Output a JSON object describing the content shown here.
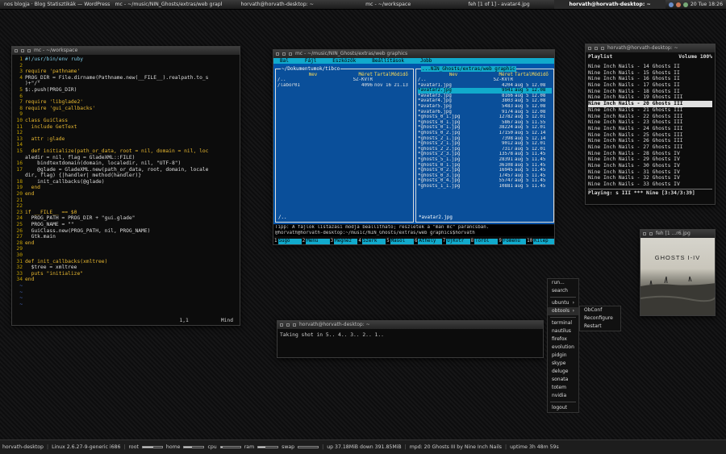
{
  "topbar": {
    "tasks": [
      {
        "label": "nos blogja · Blog Statisztikák — WordPress - M"
      },
      {
        "label": "mc - ~/music/NIN_Ghosts/extras/web graphic"
      },
      {
        "label": "horvath@horvath-desktop: ~"
      },
      {
        "label": "mc - ~/workspace"
      },
      {
        "label": "feh [1 of 1] - avatar4.jpg"
      },
      {
        "label": "horvath@horvath-desktop: ~"
      }
    ],
    "clock": "20 Tue 18:26"
  },
  "vim_window": {
    "title": "mc - ~/workspace",
    "lines": [
      {
        "n": "1",
        "text": "#!/usr/bin/env ruby"
      },
      {
        "n": "2",
        "text": ""
      },
      {
        "n": "3",
        "text": "require 'pathname'"
      },
      {
        "n": "4",
        "text": "PROG_DIR = File.dirname(Pathname.new(__FILE__).realpath.to_s"
      },
      {
        "n": "",
        "text": ")+\"/\""
      },
      {
        "n": "5",
        "text": "$:.push(PROG_DIR)"
      },
      {
        "n": "6",
        "text": ""
      },
      {
        "n": "7",
        "text": "require 'libglade2'"
      },
      {
        "n": "8",
        "text": "require 'gui_callbacks'"
      },
      {
        "n": "9",
        "text": ""
      },
      {
        "n": "10",
        "text": "class GuiClass"
      },
      {
        "n": "11",
        "text": "  include GetText"
      },
      {
        "n": "12",
        "text": ""
      },
      {
        "n": "13",
        "text": "  attr :glade"
      },
      {
        "n": "14",
        "text": ""
      },
      {
        "n": "15",
        "text": "  def initialize(path_or_data, root = nil, domain = nil, loc"
      },
      {
        "n": "",
        "text": "aledir = nil, flag = GladeXML::FILE)"
      },
      {
        "n": "16",
        "text": "    bindtextdomain(domain, localedir, nil, \"UTF-8\")"
      },
      {
        "n": "17",
        "text": "    @glade = GladeXML.new(path_or_data, root, domain, locale"
      },
      {
        "n": "",
        "text": "dir, flag) {|handler| method(handler)}"
      },
      {
        "n": "18",
        "text": "    init_callbacks(@glade)"
      },
      {
        "n": "19",
        "text": "  end"
      },
      {
        "n": "20",
        "text": "end"
      },
      {
        "n": "21",
        "text": ""
      },
      {
        "n": "22",
        "text": ""
      },
      {
        "n": "23",
        "text": "if __FILE__ == $0"
      },
      {
        "n": "24",
        "text": "  PROG_PATH = PROG_DIR + \"gui.glade\""
      },
      {
        "n": "25",
        "text": "  PROG_NAME = \"\""
      },
      {
        "n": "26",
        "text": "  GuiClass.new(PROG_PATH, nil, PROG_NAME)"
      },
      {
        "n": "27",
        "text": "  Gtk.main"
      },
      {
        "n": "28",
        "text": "end"
      },
      {
        "n": "29",
        "text": ""
      },
      {
        "n": "30",
        "text": ""
      },
      {
        "n": "31",
        "text": "def init_callbacks(xmltree)"
      },
      {
        "n": "32",
        "text": "  $tree = xmltree"
      },
      {
        "n": "33",
        "text": "  puts \"initialize\""
      },
      {
        "n": "34",
        "text": "end"
      },
      {
        "n": "~",
        "text": ""
      },
      {
        "n": "~",
        "text": ""
      },
      {
        "n": "~",
        "text": ""
      },
      {
        "n": "~",
        "text": ""
      }
    ],
    "status_pos": "1,1",
    "status_mode": "Mind"
  },
  "mc_window": {
    "title": "mc - ~/music/NIN_Ghosts/extras/web graphics",
    "menu": [
      "Bal",
      "Fájl",
      "Eszközök",
      "Beállítások",
      "Jobb"
    ],
    "left_panel": {
      "path": "~/Dokumentumok/tibco",
      "headers": [
        "Név",
        "Méret",
        "TartalMódidő"
      ],
      "rows": [
        {
          "name": "/..",
          "size": "SZ-KVTR",
          "date": ""
        },
        {
          "name": "/labor01",
          "size": "4096",
          "date": "nov 16 21.13"
        }
      ],
      "footer": "/.."
    },
    "right_panel": {
      "path": "...NIN_Ghosts/extras/web graphic",
      "headers": [
        "Név",
        "Méret",
        "TartalMódidő"
      ],
      "rows": [
        {
          "name": "/..",
          "size": "SZ-KVTR",
          "date": ""
        },
        {
          "name": "*avatar1.jpg",
          "size": "4204",
          "date": "aug  5 12.08"
        },
        {
          "name": "*avatar2.jpg",
          "size": "9941",
          "date": "aug  5 12.08"
        },
        {
          "name": "*avatar3.jpg",
          "size": "8166",
          "date": "aug  5 12.08"
        },
        {
          "name": "*avatar4.jpg",
          "size": "3803",
          "date": "aug  5 12.08"
        },
        {
          "name": "*avatar5.jpg",
          "size": "5483",
          "date": "aug  5 12.08"
        },
        {
          "name": "*avatar6.jpg",
          "size": "9174",
          "date": "aug  5 12.08"
        },
        {
          "name": "*ghosts_0_1.jpg",
          "size": "12782",
          "date": "aug  5 12.01"
        },
        {
          "name": "*ghosts_0_1.jpg",
          "size": "5867",
          "date": "aug  5 11.55"
        },
        {
          "name": "*ghosts_0_1.jpg",
          "size": "38224",
          "date": "aug  5 12.01"
        },
        {
          "name": "*ghosts_0_2.jpg",
          "size": "17150",
          "date": "aug  5 12.14"
        },
        {
          "name": "*ghosts_2_1.jpg",
          "size": "7398",
          "date": "aug  5 12.14"
        },
        {
          "name": "*ghosts_2_1.jpg",
          "size": "9012",
          "date": "aug  5 12.01"
        },
        {
          "name": "*ghosts_2_2.jpg",
          "size": "7317",
          "date": "aug  5 12.01"
        },
        {
          "name": "*ghosts_2_3.jpg",
          "size": "13578",
          "date": "aug  5 11.45"
        },
        {
          "name": "*ghosts_5_1.jpg",
          "size": "28391",
          "date": "aug  5 11.45"
        },
        {
          "name": "*ghosts_0_1.jpg",
          "size": "36108",
          "date": "aug  5 11.45"
        },
        {
          "name": "*ghosts_0_2.jpg",
          "size": "16945",
          "date": "aug  5 11.45"
        },
        {
          "name": "*ghosts_0_3.jpg",
          "size": "17457",
          "date": "aug  5 11.45"
        },
        {
          "name": "*ghosts_0_4.jpg",
          "size": "55747",
          "date": "aug  5 11.45"
        },
        {
          "name": "*ghosts_1_1.jpg",
          "size": "10881",
          "date": "aug  5 11.45"
        }
      ],
      "selected_index": 2,
      "footer": "*avatar2.jpg"
    },
    "hint": "Tipp: A fájlok listázási módja beállítható; részletek a \"man mc\" parancsban.",
    "prompt": "@horvath@horvath-desktop:~/music/NIN_Ghosts/extras/web graphics$horvath",
    "fkeys": [
      {
        "n": "1",
        "l": "Súgó"
      },
      {
        "n": "2",
        "l": "Menü"
      },
      {
        "n": "3",
        "l": "Megnéz"
      },
      {
        "n": "4",
        "l": "Szerk"
      },
      {
        "n": "5",
        "l": "Másol"
      },
      {
        "n": "6",
        "l": "Áthely"
      },
      {
        "n": "7",
        "l": "ÚjKvtr"
      },
      {
        "n": "8",
        "l": "Töröl"
      },
      {
        "n": "9",
        "l": "Főmenü"
      },
      {
        "n": "10",
        "l": "Kilép"
      }
    ]
  },
  "playlist_window": {
    "title": "horvath@horvath-desktop: ~",
    "header_left": "Playlist",
    "header_right": "Volume 100%",
    "items": [
      "Nine Inch Nails - 14 Ghosts II",
      "Nine Inch Nails - 15 Ghosts II",
      "Nine Inch Nails - 16 Ghosts II",
      "Nine Inch Nails - 17 Ghosts II",
      "Nine Inch Nails - 18 Ghosts II",
      "Nine Inch Nails - 19 Ghosts III",
      "Nine Inch Nails - 20 Ghosts III",
      "Nine Inch Nails - 21 Ghosts III",
      "Nine Inch Nails - 22 Ghosts III",
      "Nine Inch Nails - 23 Ghosts III",
      "Nine Inch Nails - 24 Ghosts III",
      "Nine Inch Nails - 25 Ghosts III",
      "Nine Inch Nails - 26 Ghosts III",
      "Nine Inch Nails - 27 Ghosts III",
      "Nine Inch Nails - 28 Ghosts IV",
      "Nine Inch Nails - 29 Ghosts IV",
      "Nine Inch Nails - 30 Ghosts IV",
      "Nine Inch Nails - 31 Ghosts IV",
      "Nine Inch Nails - 32 Ghosts IV",
      "Nine Inch Nails - 33 Ghosts IV"
    ],
    "current_index": 6,
    "status": "Playing: s III *** Nine  [3:34/3:39]"
  },
  "feh_window": {
    "title": "feh [1 ...r6.jpg",
    "cover_text": "GHOSTS I-IV"
  },
  "shot_window": {
    "title": "horvath@horvath-desktop: ~",
    "text": "Taking shot in 5.. 4.. 3.. 2.. 1.."
  },
  "root_menu": {
    "items": [
      {
        "label": "run...",
        "arrow": ""
      },
      {
        "label": "search",
        "arrow": ""
      },
      {
        "label": "ubuntu",
        "arrow": "›"
      },
      {
        "label": "obtools",
        "arrow": "›"
      },
      {
        "label": "terminal",
        "arrow": ""
      },
      {
        "label": "nautilus",
        "arrow": ""
      },
      {
        "label": "firefox",
        "arrow": ""
      },
      {
        "label": "evolution",
        "arrow": ""
      },
      {
        "label": "pidgin",
        "arrow": ""
      },
      {
        "label": "skype",
        "arrow": ""
      },
      {
        "label": "deluge",
        "arrow": ""
      },
      {
        "label": "sonata",
        "arrow": ""
      },
      {
        "label": "totem",
        "arrow": ""
      },
      {
        "label": "nvidia",
        "arrow": ""
      },
      {
        "label": "logout",
        "arrow": ""
      }
    ],
    "submenu": [
      "ObConf",
      "Reconfigure",
      "Restart"
    ]
  },
  "bottombar": {
    "host": "horvath-desktop",
    "kernel": "Linux 2.6.27-9-generic i686",
    "root_label": "root",
    "root_fill": 0.55,
    "home_label": "home",
    "home_fill": 0.4,
    "cpu_label": "cpu",
    "cpu_fill": 0.1,
    "ram_label": "ram",
    "ram_fill": 0.35,
    "swap_label": "swap",
    "swap_fill": 0.0,
    "net": "up 37.18MiB down 391.85MiB",
    "mpd": "mpd: 20 Ghosts III by Nine Inch Nails",
    "uptime": "uptime 3h 48m 59s"
  }
}
